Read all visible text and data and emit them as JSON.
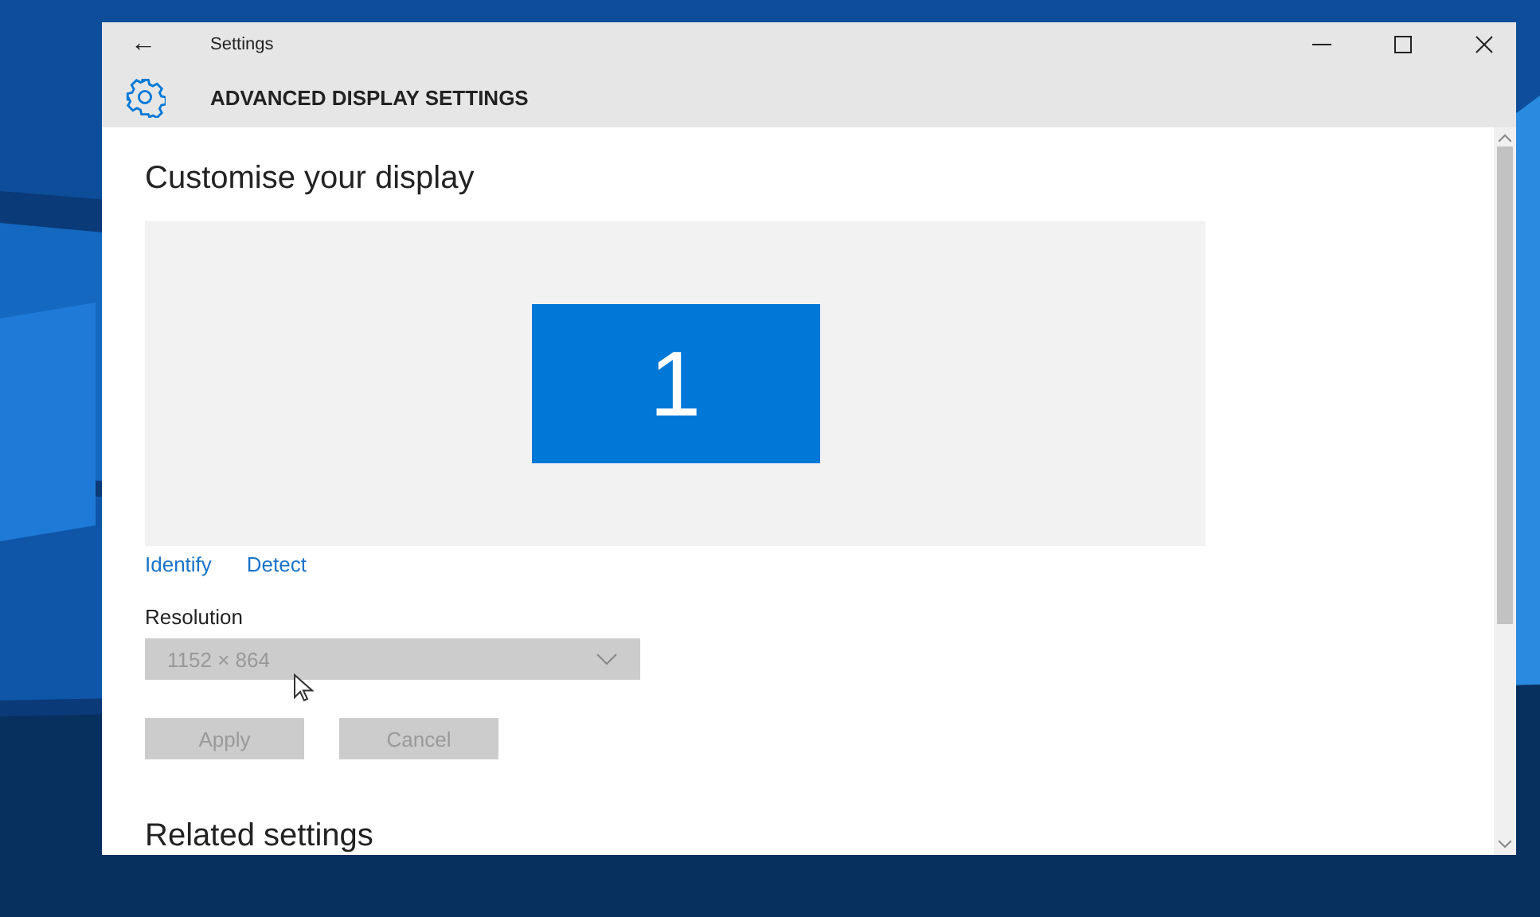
{
  "window": {
    "title": "Settings",
    "back": "←",
    "header": "ADVANCED DISPLAY SETTINGS"
  },
  "content": {
    "heading": "Customise your display",
    "monitors": [
      {
        "label": "1",
        "selected": true
      }
    ],
    "links": [
      "Identify",
      "Detect"
    ],
    "resolution": {
      "label": "Resolution",
      "value": "1152 × 864",
      "disabled": true
    },
    "buttons": [
      {
        "label": "Apply",
        "disabled": true
      },
      {
        "label": "Cancel",
        "disabled": true
      }
    ],
    "section": "Related settings"
  }
}
